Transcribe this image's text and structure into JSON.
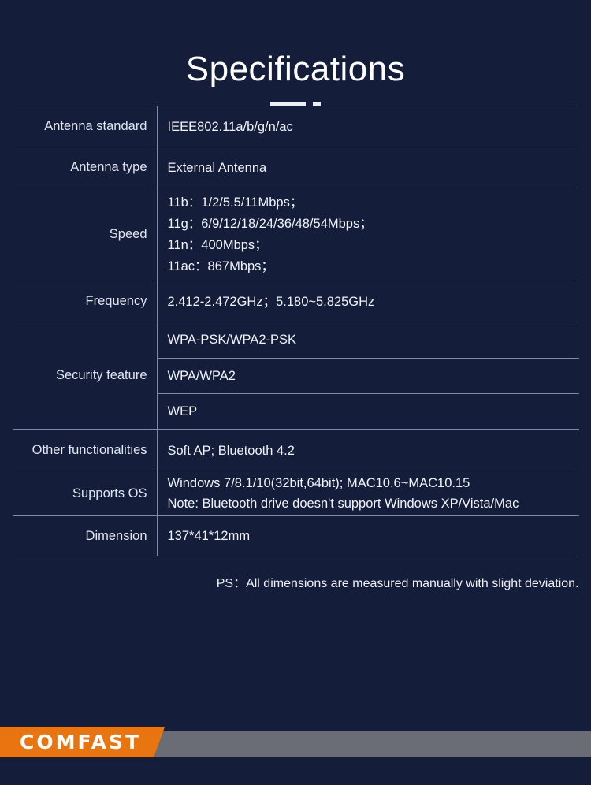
{
  "page": {
    "title": "Specifications",
    "background_color": "#141D39",
    "text_color": "#F1F3F8",
    "rule_color": "#7D8AAA"
  },
  "table": {
    "rows": [
      {
        "label": "Antenna standard",
        "values": [
          "IEEE802.11a/b/g/n/ac"
        ]
      },
      {
        "label": "Antenna type",
        "values": [
          "External Antenna"
        ]
      },
      {
        "label": "Speed",
        "values": [
          "11b：1/2/5.5/11Mbps；",
          "11g：6/9/12/18/24/36/48/54Mbps；",
          "11n：400Mbps；",
          "11ac：867Mbps；"
        ]
      },
      {
        "label": "Frequency",
        "values": [
          "2.412-2.472GHz；5.180~5.825GHz"
        ]
      },
      {
        "label": "Security feature",
        "sub_values": [
          "WPA-PSK/WPA2-PSK",
          "WPA/WPA2",
          "WEP"
        ]
      },
      {
        "label": "Other functionalities",
        "values": [
          "Soft AP; Bluetooth 4.2"
        ]
      },
      {
        "label": "Supports OS",
        "values": [
          "Windows 7/8.1/10(32bit,64bit); MAC10.6~MAC10.15",
          "Note: Bluetooth drive doesn't support Windows XP/Vista/Mac"
        ]
      },
      {
        "label": "Dimension",
        "values": [
          "137*41*12mm"
        ]
      }
    ]
  },
  "note": {
    "text": "PS：All dimensions are measured manually with slight deviation."
  },
  "footer": {
    "brand": "COMFAST",
    "orange_color": "#E8750F",
    "gray_color": "#6A6D75"
  }
}
